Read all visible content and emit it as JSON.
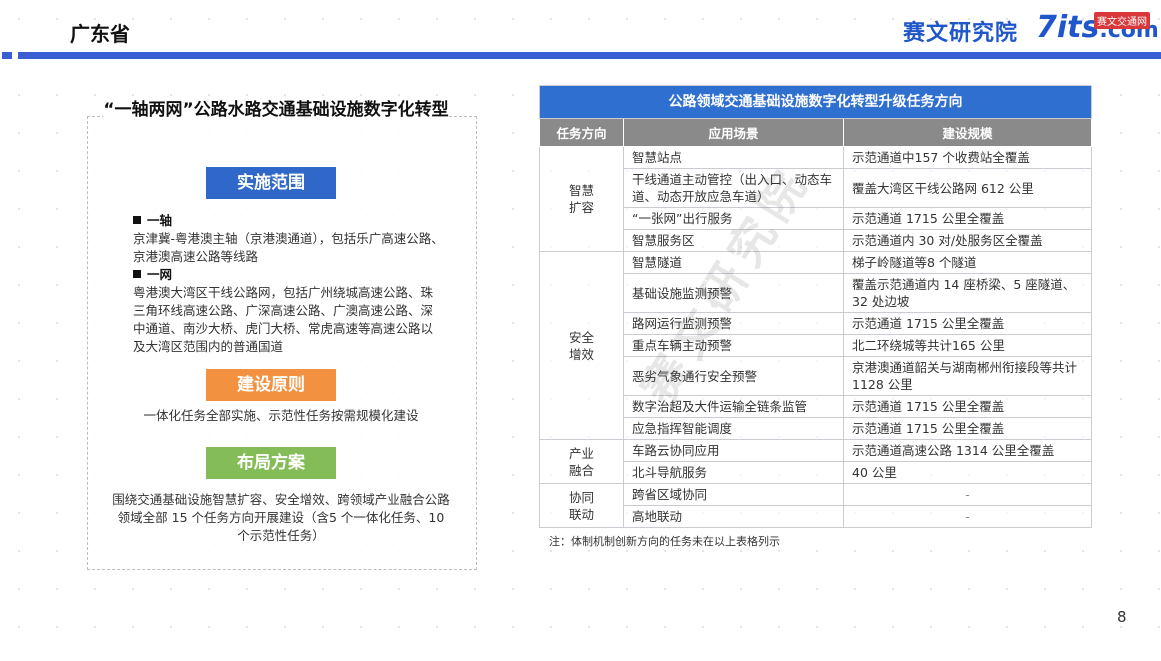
{
  "header": {
    "title": "广东省",
    "logo_cn": "赛文研究院",
    "logo_en": "7its",
    "logo_en_suffix": ".com",
    "logo_badge": "赛文交通网"
  },
  "left": {
    "title": "“一轴两网”公路水路交通基础设施数字化转型",
    "scope_tag": "实施范围",
    "axis_head": "一轴",
    "axis_text": "京津冀-粤港澳主轴（京港澳通道），包括乐广高速公路、京港澳高速公路等线路",
    "net_head": "一网",
    "net_text": "粤港澳大湾区干线公路网，包括广州绕城高速公路、珠三角环线高速公路、广深高速公路、广澳高速公路、深中通道、南沙大桥、虎门大桥、常虎高速等高速公路以及大湾区范围内的普通国道",
    "principle_tag": "建设原则",
    "principle_text": "一体化任务全部实施、示范性任务按需规模化建设",
    "layout_tag": "布局方案",
    "layout_text": "围绕交通基础设施智慧扩容、安全增效、跨领域产业融合公路领域全部 15 个任务方向开展建设（含5 个一体化任务、10 个示范性任务）"
  },
  "table": {
    "title": "公路领域交通基础设施数字化转型升级任务方向",
    "headers": [
      "任务方向",
      "应用场景",
      "建设规模"
    ],
    "groups": [
      {
        "category": "智慧扩容",
        "rows": [
          {
            "scene": "智慧站点",
            "scale": "示范通道中157 个收费站全覆盖"
          },
          {
            "scene": "干线通道主动管控（出入口、动态车道、动态开放应急车道）",
            "scale": "覆盖大湾区干线公路网 612 公里"
          },
          {
            "scene": "“一张网”出行服务",
            "scale": "示范通道 1715 公里全覆盖"
          },
          {
            "scene": "智慧服务区",
            "scale": "示范通道内 30 对/处服务区全覆盖"
          }
        ]
      },
      {
        "category": "安全增效",
        "rows": [
          {
            "scene": "智慧隧道",
            "scale": "梯子岭隧道等8 个隧道"
          },
          {
            "scene": "基础设施监测预警",
            "scale": "覆盖示范通道内 14 座桥梁、5 座隧道、32 处边坡"
          },
          {
            "scene": "路网运行监测预警",
            "scale": "示范通道 1715 公里全覆盖"
          },
          {
            "scene": "重点车辆主动预警",
            "scale": "北二环绕城等共计165 公里"
          },
          {
            "scene": "恶劣气象通行安全预警",
            "scale": "京港澳通道韶关与湖南郴州衔接段等共计1128 公里"
          },
          {
            "scene": "数字治超及大件运输全链条监管",
            "scale": "示范通道 1715 公里全覆盖"
          },
          {
            "scene": "应急指挥智能调度",
            "scale": "示范通道 1715 公里全覆盖"
          }
        ]
      },
      {
        "category": "产业融合",
        "rows": [
          {
            "scene": "车路云协同应用",
            "scale": "示范通道高速公路 1314 公里全覆盖"
          },
          {
            "scene": "北斗导航服务",
            "scale": "40 公里"
          }
        ]
      },
      {
        "category": "协同联动",
        "rows": [
          {
            "scene": "跨省区域协同",
            "scale": "-"
          },
          {
            "scene": "高地联动",
            "scale": "-"
          }
        ]
      }
    ],
    "note": "注：体制机制创新方向的任务未在以上表格列示"
  },
  "watermark": "赛文研究院",
  "page_number": "8"
}
